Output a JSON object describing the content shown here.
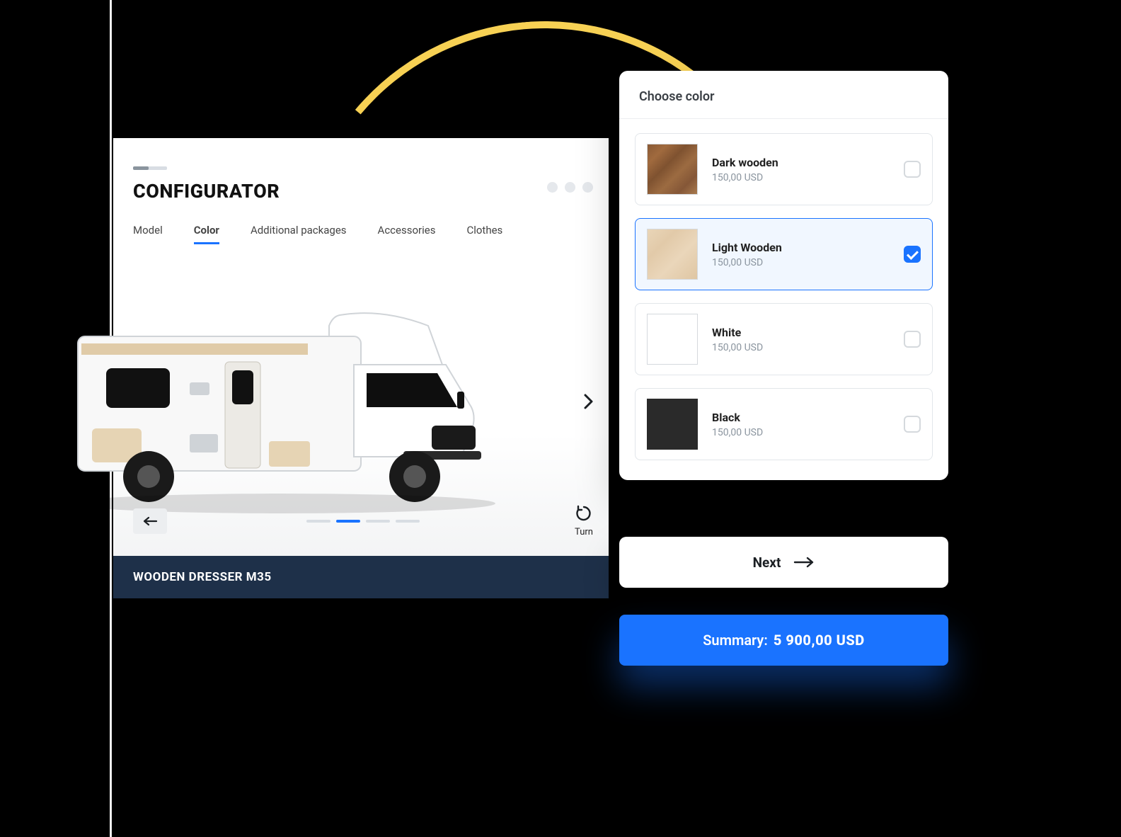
{
  "configurator": {
    "title": "CONFIGURATOR",
    "tabs": [
      "Model",
      "Color",
      "Additional packages",
      "Accessories",
      "Clothes"
    ],
    "active_tab_index": 1,
    "turn_label": "Turn",
    "step_active_index": 1,
    "step_count": 4
  },
  "product": {
    "name": "WOODEN DRESSER M35"
  },
  "color_panel": {
    "heading": "Choose color",
    "options": [
      {
        "name": "Dark wooden",
        "price": "150,00 USD",
        "swatch": "dark-wood",
        "selected": false
      },
      {
        "name": "Light Wooden",
        "price": "150,00 USD",
        "swatch": "light-wood",
        "selected": true
      },
      {
        "name": "White",
        "price": "150,00 USD",
        "swatch": "white",
        "selected": false
      },
      {
        "name": "Black",
        "price": "150,00 USD",
        "swatch": "black",
        "selected": false
      }
    ]
  },
  "actions": {
    "next_label": "Next"
  },
  "summary": {
    "label": "Summary:",
    "value": "5 900,00 USD"
  }
}
